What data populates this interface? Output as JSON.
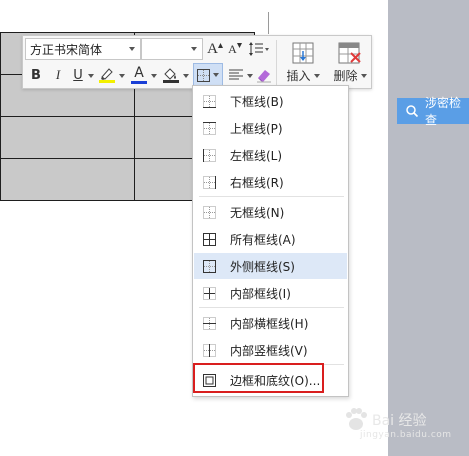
{
  "toolbar": {
    "font_name": "方正书宋简体",
    "font_size": "",
    "grow_font": "A",
    "shrink_font": "A",
    "bold": "B",
    "italic": "I",
    "underline": "U",
    "font_color_letter": "A",
    "insert_label": "插入",
    "delete_label": "删除",
    "font_color": "#1a3fd6",
    "highlight_color": "#f3f000"
  },
  "border_menu": {
    "items": [
      {
        "label": "下框线(B)",
        "icon": "bottom-border-icon"
      },
      {
        "label": "上框线(P)",
        "icon": "top-border-icon"
      },
      {
        "label": "左框线(L)",
        "icon": "left-border-icon"
      },
      {
        "label": "右框线(R)",
        "icon": "right-border-icon"
      },
      {
        "label": "无框线(N)",
        "icon": "no-border-icon"
      },
      {
        "label": "所有框线(A)",
        "icon": "all-borders-icon"
      },
      {
        "label": "外侧框线(S)",
        "icon": "outside-borders-icon",
        "active": true
      },
      {
        "label": "内部框线(I)",
        "icon": "inside-borders-icon"
      },
      {
        "label": "内部横框线(H)",
        "icon": "inside-horizontal-border-icon"
      },
      {
        "label": "内部竖框线(V)",
        "icon": "inside-vertical-border-icon"
      },
      {
        "label": "边框和底纹(O)...",
        "icon": "borders-and-shading-icon"
      }
    ],
    "highlight_color": "#d91e1e"
  },
  "side_panel": {
    "privacy_check_label": "涉密检查",
    "accent_color": "#5a9ee6"
  },
  "watermark": {
    "text": "Bai 经验",
    "url": "jingyan.baidu.com"
  }
}
